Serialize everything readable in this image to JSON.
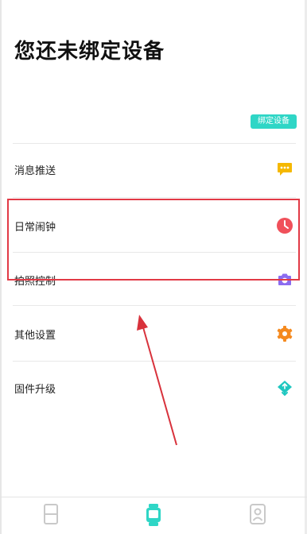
{
  "header": {
    "title": "您还未绑定设备"
  },
  "bind_button": {
    "label": "绑定设备",
    "color": "#2fd6c6"
  },
  "menu": {
    "items": [
      {
        "label": "消息推送",
        "icon": "message-bubble-icon",
        "icon_color": "#f5b800"
      },
      {
        "label": "日常闹钟",
        "icon": "clock-icon",
        "icon_color": "#f0505a"
      },
      {
        "label": "拍照控制",
        "icon": "camera-icon",
        "icon_color": "#8b6cf0"
      },
      {
        "label": "其他设置",
        "icon": "gear-icon",
        "icon_color": "#f58a1f"
      },
      {
        "label": "固件升级",
        "icon": "upload-cloud-icon",
        "icon_color": "#1fc7c0"
      }
    ]
  },
  "tabbar": {
    "tabs": [
      {
        "icon": "page-icon",
        "active": false
      },
      {
        "icon": "watch-icon",
        "active": true
      },
      {
        "icon": "profile-icon",
        "active": false
      }
    ],
    "active_color": "#2fd6c6",
    "inactive_color": "#c9c9c9"
  },
  "annotation": {
    "highlight_color": "#e23a46"
  }
}
